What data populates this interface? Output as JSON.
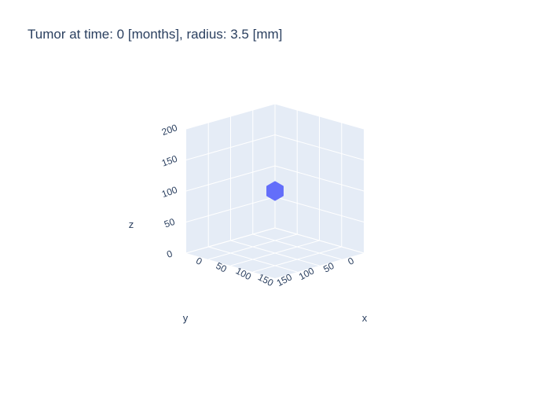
{
  "chart_data": {
    "type": "scatter3d",
    "title": "Tumor at time: 0 [months], radius: 3.5 [mm]",
    "axes": {
      "x": {
        "label": "x",
        "ticks": [
          "0",
          "50",
          "100",
          "150"
        ]
      },
      "y": {
        "label": "y",
        "ticks": [
          "0",
          "50",
          "100",
          "150"
        ]
      },
      "z": {
        "label": "z",
        "ticks": [
          "0",
          "50",
          "100",
          "150",
          "200"
        ]
      }
    },
    "xlim": [
      0,
      200
    ],
    "ylim": [
      0,
      200
    ],
    "zlim": [
      0,
      200
    ],
    "series": [
      {
        "mesh": "sphere",
        "center": [
          100,
          100,
          100
        ],
        "radius": 3.5,
        "color": "#636efa"
      }
    ],
    "scene_background": "#e5ecf6",
    "grid_color": "#ffffff",
    "grid": true
  }
}
